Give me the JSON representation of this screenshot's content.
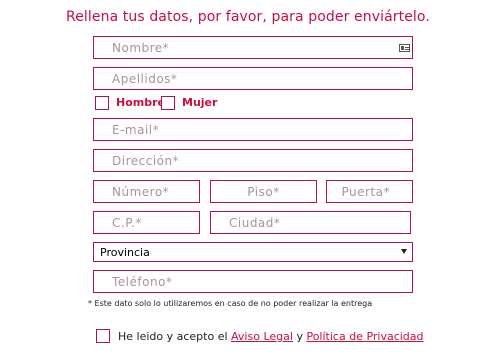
{
  "heading": "Rellena tus datos, por favor, para poder enviártelo.",
  "fields": {
    "nombre": "Nombre*",
    "apellidos": "Apellidos*",
    "email": "E-mail*",
    "direccion": "Dirección*",
    "numero": "Número*",
    "piso": "Piso*",
    "puerta": "Puerta*",
    "cp": "C.P.*",
    "ciudad": "Ciudad*",
    "telefono": "Teléfono*"
  },
  "gender": {
    "hombre": "Hombre",
    "mujer": "Mujer"
  },
  "provincia": {
    "selected": "Provincia"
  },
  "note": "* Este dato solo lo utilizaremos en caso de no poder realizar la entrega",
  "accept": {
    "text": "He leido y acepto el",
    "aviso_legal": "Aviso Legal",
    "and": "y",
    "politica": "Política de Privacidad"
  },
  "colors": {
    "accent": "#c8103e",
    "border": "#b01242",
    "placeholder": "#b08fa0"
  },
  "icons": {
    "contact_card": "contact-card-icon",
    "select_arrow": "chevron-down-icon"
  }
}
